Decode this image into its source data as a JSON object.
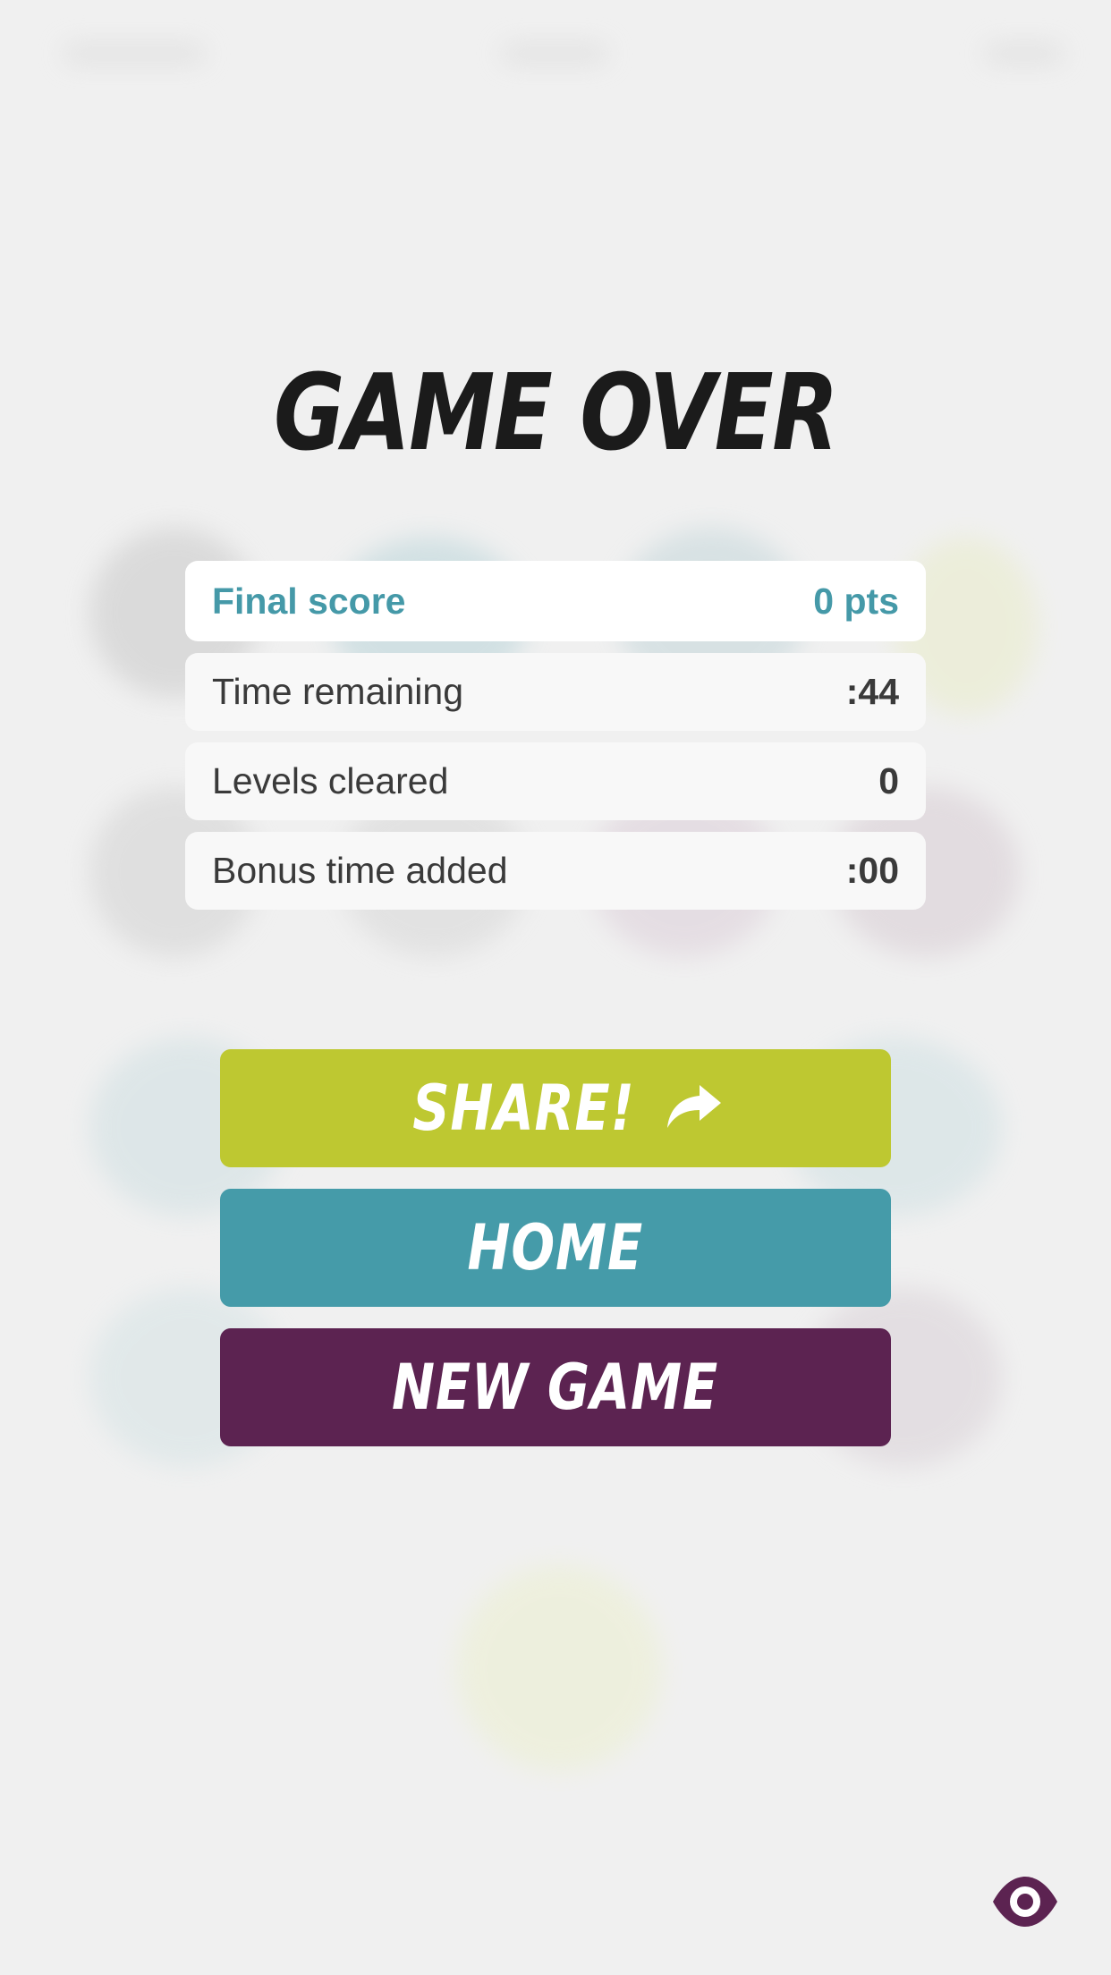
{
  "title": "GAME OVER",
  "stats": [
    {
      "label": "Final score",
      "value": "0 pts"
    },
    {
      "label": "Time remaining",
      "value": ":44"
    },
    {
      "label": "Levels cleared",
      "value": "0"
    },
    {
      "label": "Bonus time added",
      "value": ":00"
    }
  ],
  "buttons": {
    "share": "SHARE!",
    "home": "HOME",
    "new_game": "NEW GAME"
  },
  "colors": {
    "background": "#f0f0f0",
    "accent_teal": "#4599a8",
    "share_green": "#bec831",
    "home_teal": "#459ba9",
    "new_game_purple": "#5c2351",
    "title": "#1b1b1b"
  },
  "icons": {
    "share": "share-arrow-icon",
    "visibility": "eye-icon"
  }
}
